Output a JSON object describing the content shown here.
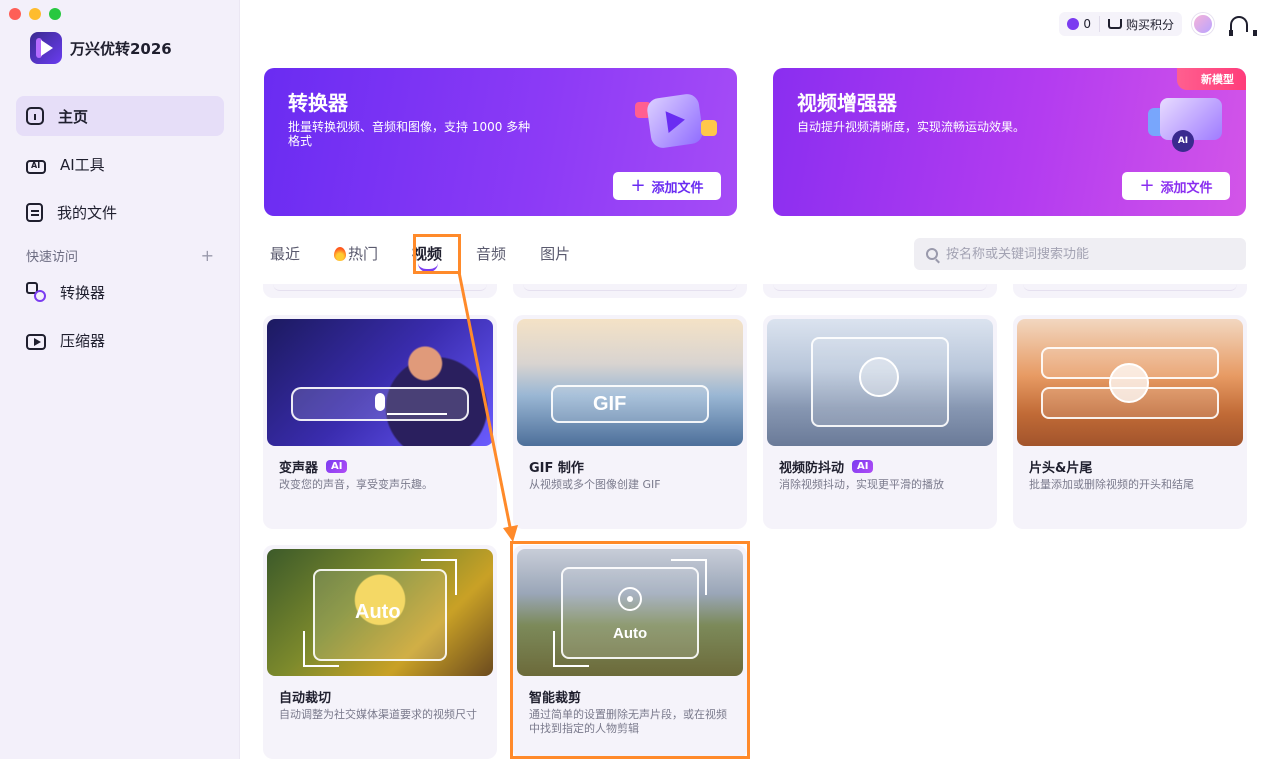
{
  "app": {
    "name": "万兴优转2026"
  },
  "sidebar": {
    "items": [
      {
        "label": "主页",
        "icon": "home-icon",
        "active": true
      },
      {
        "label": "AI工具",
        "icon": "ai-tools-icon"
      },
      {
        "label": "我的文件",
        "icon": "file-icon"
      }
    ],
    "quick_access_label": "快速访问",
    "quick_items": [
      {
        "label": "转换器",
        "icon": "converter-icon"
      },
      {
        "label": "压缩器",
        "icon": "compressor-icon"
      }
    ]
  },
  "topbar": {
    "points": "0",
    "buy_label": "购买积分"
  },
  "banners": [
    {
      "title": "转换器",
      "desc": "批量转换视频、音频和图像，支持 1000 多种格式",
      "button": "添加文件"
    },
    {
      "title": "视频增强器",
      "desc": "自动提升视频清晰度，实现流畅运动效果。",
      "button": "添加文件",
      "badge": "新模型"
    }
  ],
  "tabs": [
    "最近",
    "热门",
    "视频",
    "音频",
    "图片"
  ],
  "active_tab": "视频",
  "search": {
    "placeholder": "按名称或关键词搜索功能"
  },
  "cards": [
    {
      "title": "变声器",
      "ai": "AI",
      "desc": "改变您的声音，享受变声乐趣。"
    },
    {
      "title": "GIF 制作",
      "desc": "从视频或多个图像创建 GIF",
      "overlay": "GIF"
    },
    {
      "title": "视频防抖动",
      "ai": "AI",
      "desc": "消除视频抖动，实现更平滑的播放"
    },
    {
      "title": "片头&片尾",
      "desc": "批量添加或删除视频的开头和结尾"
    },
    {
      "title": "自动裁切",
      "desc": "自动调整为社交媒体渠道要求的视频尺寸",
      "overlay": "Auto"
    },
    {
      "title": "智能裁剪",
      "desc": "通过简单的设置删除无声片段，或在视频中找到指定的人物剪辑",
      "overlay": "Auto"
    }
  ],
  "colors": {
    "accent": "#7b3cf0",
    "highlight": "#ff8a2a",
    "sidebar_bg": "#f3f0fa"
  }
}
